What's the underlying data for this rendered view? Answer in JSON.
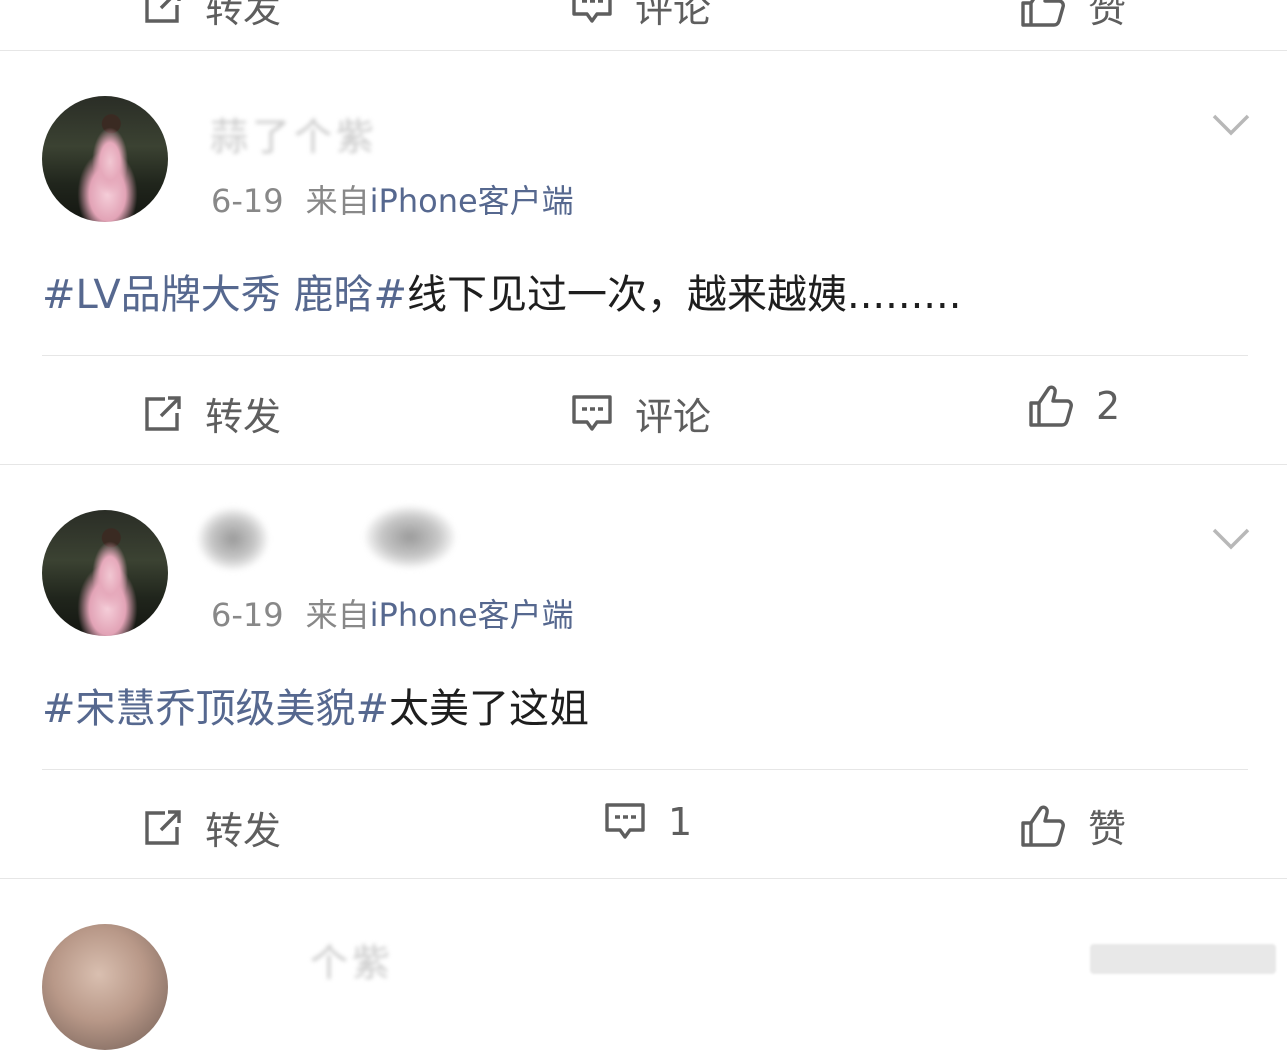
{
  "top_actions": {
    "repost": "转发",
    "comment": "评论",
    "like": "赞"
  },
  "posts": [
    {
      "username": "蒜了个紫",
      "time": "6-19",
      "source_prefix": "来自",
      "source": "iPhone客户端",
      "hashtag": "#LV品牌大秀 鹿晗#",
      "text": "线下见过一次，越来越姨.........",
      "actions": {
        "repost": "转发",
        "comment": "评论",
        "like": "2"
      }
    },
    {
      "username": "",
      "time": "6-19",
      "source_prefix": "来自",
      "source": "iPhone客户端",
      "hashtag": "#宋慧乔顶级美貌#",
      "text": "太美了这姐",
      "actions": {
        "repost": "转发",
        "comment": "1",
        "like": "赞"
      }
    }
  ],
  "bottom_partial": {
    "username": "个紫"
  },
  "icons": [
    "repost-icon",
    "comment-icon",
    "like-icon",
    "chevron-down-icon"
  ],
  "colors": {
    "link": "#56688f",
    "text": "#1e1e1e",
    "meta": "#888888",
    "divider": "#e6e6e6"
  }
}
